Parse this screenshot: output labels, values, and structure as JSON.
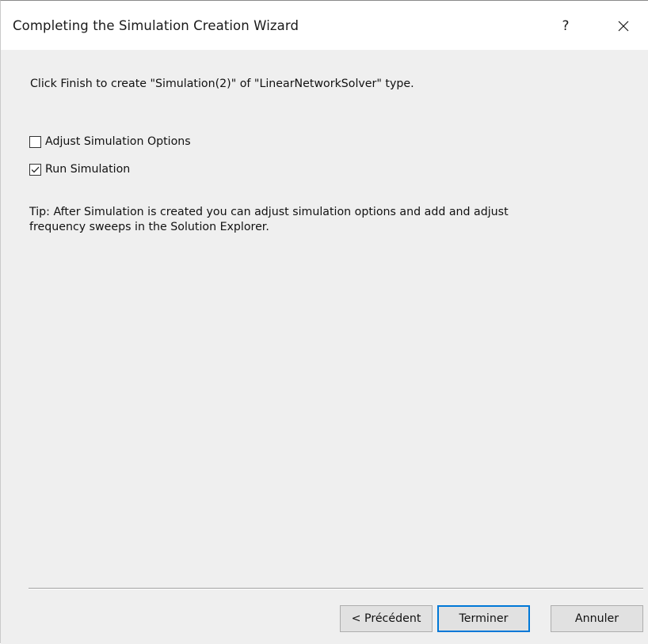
{
  "window": {
    "title": "Completing the Simulation Creation Wizard",
    "help_label": "?",
    "close_icon": "close-icon"
  },
  "content": {
    "intro": "Click Finish to create \"Simulation(2)\" of \"LinearNetworkSolver\" type.",
    "options": [
      {
        "label": "Adjust Simulation Options",
        "checked": false
      },
      {
        "label": "Run Simulation",
        "checked": true
      }
    ],
    "tip": "Tip: After Simulation is created you can adjust simulation options and add and adjust frequency sweeps in the Solution Explorer."
  },
  "buttons": {
    "prev_label": "< Précédent",
    "finish_label": "Terminer",
    "cancel_label": "Annuler"
  },
  "colors": {
    "focus_border": "#0078d7",
    "dialog_background": "#efefef"
  }
}
